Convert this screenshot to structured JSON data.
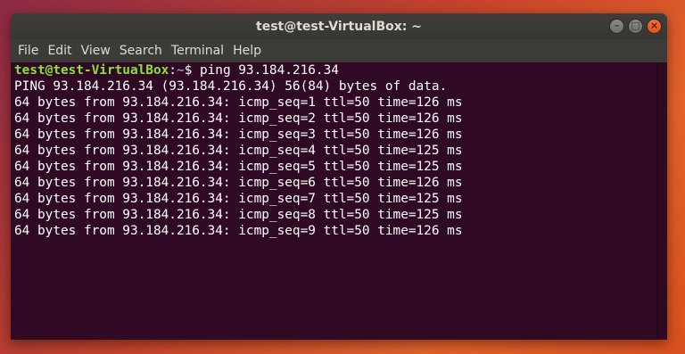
{
  "window": {
    "title": "test@test-VirtualBox: ~"
  },
  "controls": {
    "minimize": "–",
    "maximize": "□",
    "close": "×"
  },
  "menu": {
    "items": [
      {
        "label": "File"
      },
      {
        "label": "Edit"
      },
      {
        "label": "View"
      },
      {
        "label": "Search"
      },
      {
        "label": "Terminal"
      },
      {
        "label": "Help"
      }
    ]
  },
  "terminal": {
    "prompt": {
      "user_host": "test@test-VirtualBox",
      "separator": ":",
      "path": "~",
      "symbol": "$ ",
      "command": "ping 93.184.216.34"
    },
    "output": [
      "PING 93.184.216.34 (93.184.216.34) 56(84) bytes of data.",
      "64 bytes from 93.184.216.34: icmp_seq=1 ttl=50 time=126 ms",
      "64 bytes from 93.184.216.34: icmp_seq=2 ttl=50 time=126 ms",
      "64 bytes from 93.184.216.34: icmp_seq=3 ttl=50 time=126 ms",
      "64 bytes from 93.184.216.34: icmp_seq=4 ttl=50 time=125 ms",
      "64 bytes from 93.184.216.34: icmp_seq=5 ttl=50 time=125 ms",
      "64 bytes from 93.184.216.34: icmp_seq=6 ttl=50 time=126 ms",
      "64 bytes from 93.184.216.34: icmp_seq=7 ttl=50 time=125 ms",
      "64 bytes from 93.184.216.34: icmp_seq=8 ttl=50 time=125 ms",
      "64 bytes from 93.184.216.34: icmp_seq=9 ttl=50 time=126 ms"
    ]
  },
  "colors": {
    "terminal_bg": "#300a24",
    "prompt_user": "#8ae234",
    "prompt_path": "#729fcf",
    "titlebar": "#3c3b37",
    "close_button": "#e95420"
  }
}
